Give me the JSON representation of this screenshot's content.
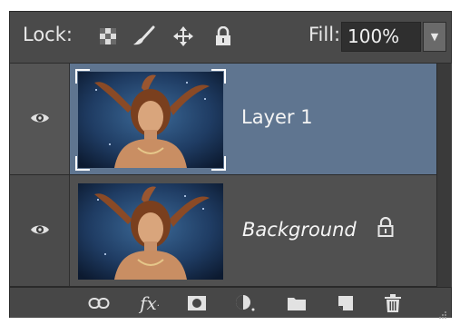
{
  "lockbar": {
    "lock_label": "Lock:",
    "fill_label": "Fill:",
    "fill_value": "100%",
    "icons": [
      "lock-transparent-pixels-icon",
      "lock-image-pixels-icon",
      "lock-position-icon",
      "lock-all-icon"
    ]
  },
  "layers": [
    {
      "name": "Layer 1",
      "selected": true,
      "visible": true,
      "locked": false
    },
    {
      "name": "Background",
      "selected": false,
      "visible": true,
      "locked": true
    }
  ],
  "toolbar": {
    "icons": [
      "link-layers-icon",
      "layer-style-fx-icon",
      "add-mask-icon",
      "adjustment-layer-icon",
      "new-group-folder-icon",
      "new-layer-icon",
      "delete-layer-icon"
    ]
  },
  "colors": {
    "panel_bg": "#3f3f3f",
    "selected_row": "#5f7590",
    "row_bg": "#505050"
  }
}
